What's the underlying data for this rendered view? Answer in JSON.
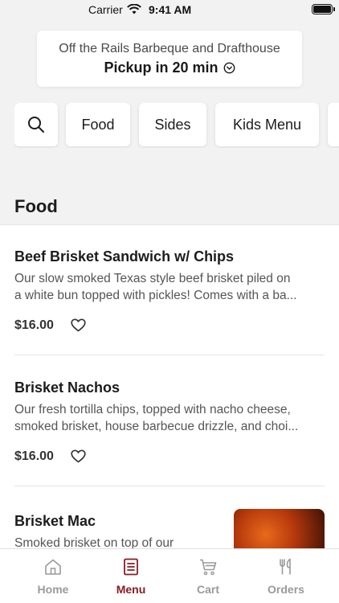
{
  "status_bar": {
    "carrier": "Carrier",
    "time": "9:41 AM"
  },
  "location": {
    "restaurant": "Off the Rails Barbeque and Drafthouse",
    "pickup": "Pickup in 20 min"
  },
  "categories": [
    "Food",
    "Sides",
    "Kids Menu"
  ],
  "section": {
    "title": "Food"
  },
  "items": [
    {
      "name": "Beef Brisket Sandwich w/ Chips",
      "description_lines": [
        "Our slow smoked Texas style beef brisket piled on",
        "a white bun topped with pickles! Comes with a ba..."
      ],
      "price": "$16.00"
    },
    {
      "name": "Brisket Nachos",
      "description_lines": [
        "Our fresh tortilla chips, topped with nacho cheese,",
        "smoked brisket, house barbecue drizzle, and choi..."
      ],
      "price": "$16.00"
    },
    {
      "name": "Brisket Mac",
      "description_lines": [
        "Smoked brisket on top of our"
      ]
    }
  ],
  "tabs": [
    {
      "label": "Home",
      "icon": "home-icon"
    },
    {
      "label": "Menu",
      "icon": "menu-icon"
    },
    {
      "label": "Cart",
      "icon": "cart-icon"
    },
    {
      "label": "Orders",
      "icon": "orders-icon"
    }
  ],
  "colors": {
    "accent": "#8b1a22",
    "inactive": "#9a9a9a"
  }
}
